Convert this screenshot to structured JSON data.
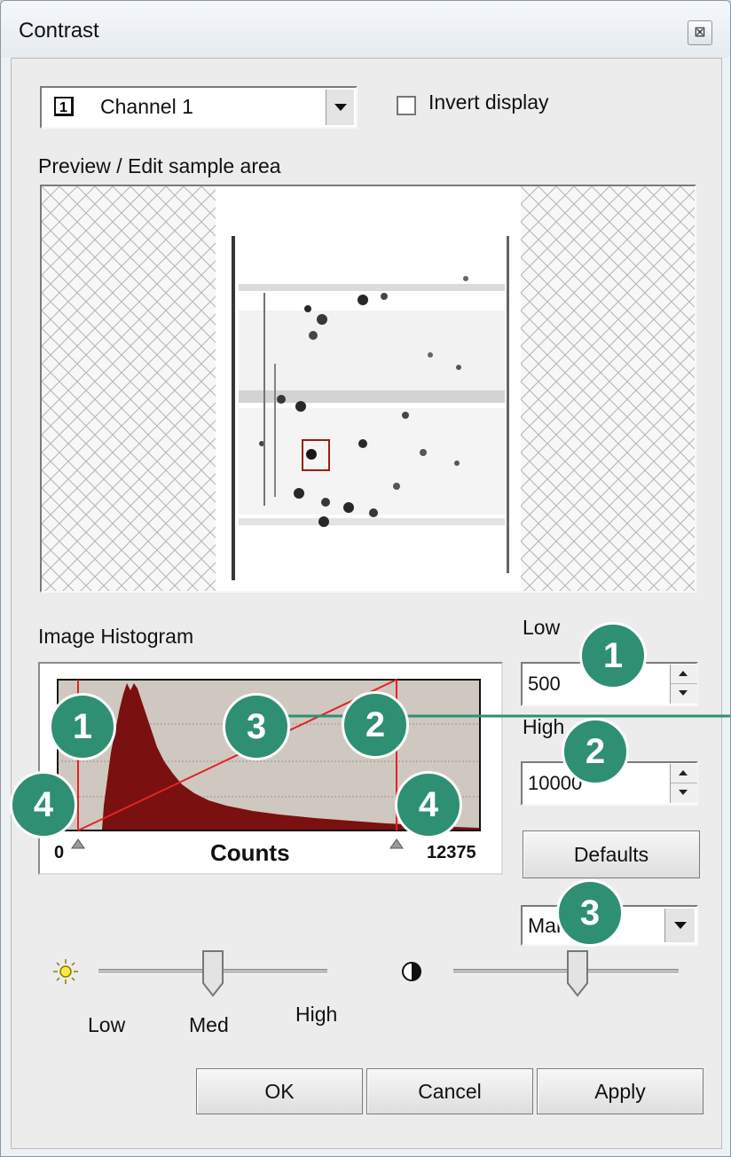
{
  "window": {
    "title": "Contrast",
    "close_label": "⊠"
  },
  "channel": {
    "number": "1",
    "selected": "Channel 1"
  },
  "invert": {
    "label": "Invert display",
    "checked": false
  },
  "preview": {
    "label": "Preview / Edit sample area"
  },
  "histogram": {
    "label": "Image Histogram",
    "axis_min": "0",
    "axis_title": "Counts",
    "axis_max": "12375",
    "low_marker": 500,
    "high_marker": 10000,
    "max_value": 12375
  },
  "low": {
    "label": "Low",
    "value": "500"
  },
  "high": {
    "label": "High",
    "value": "10000"
  },
  "defaults_label": "Defaults",
  "mode": {
    "selected": "Manual"
  },
  "brightness": {
    "icon": "sun-icon",
    "labels": {
      "low": "Low",
      "med": "Med",
      "high": "High"
    },
    "level": 0.5
  },
  "contrast_slider": {
    "icon": "half-circle-icon",
    "level": 0.55
  },
  "buttons": {
    "ok": "OK",
    "cancel": "Cancel",
    "apply": "Apply"
  },
  "annotations": {
    "badges": [
      "1",
      "2",
      "3",
      "4"
    ]
  },
  "colors": {
    "histogram_fill": "#7b1010",
    "histogram_bg": "#cfc8c0",
    "marker_line": "#e02424",
    "badge": "#2f8f73",
    "callout_arrow": "#2f8f73"
  }
}
